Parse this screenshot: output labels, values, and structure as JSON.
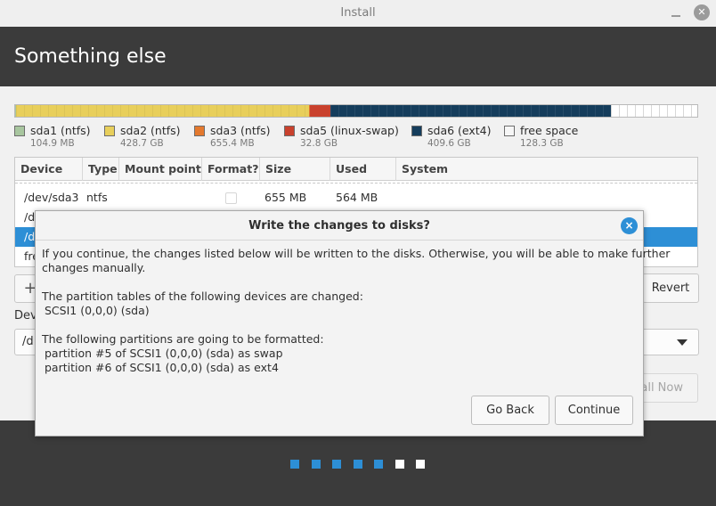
{
  "window": {
    "title": "Install"
  },
  "header": {
    "title": "Something else"
  },
  "partition_bar": [
    {
      "color": "#a8c69f",
      "share": 0.0001
    },
    {
      "color": "#e8cf5b",
      "share": 0.43
    },
    {
      "color": "#e4792e",
      "share": 0.0008
    },
    {
      "color": "#c9412d",
      "share": 0.03
    },
    {
      "color": "#153d5c",
      "share": 0.412
    },
    {
      "color": "#ffffff",
      "share": 0.127
    }
  ],
  "legend": [
    {
      "name": "sda1 (ntfs)",
      "size": "104.9 MB",
      "color": "#a8c69f"
    },
    {
      "name": "sda2 (ntfs)",
      "size": "428.7 GB",
      "color": "#e8cf5b"
    },
    {
      "name": "sda3 (ntfs)",
      "size": "655.4 MB",
      "color": "#e4792e"
    },
    {
      "name": "sda5 (linux-swap)",
      "size": "32.8 GB",
      "color": "#c9412d"
    },
    {
      "name": "sda6 (ext4)",
      "size": "409.6 GB",
      "color": "#153d5c"
    },
    {
      "name": "free space",
      "size": "128.3 GB",
      "color": "#f6f6f6"
    }
  ],
  "table": {
    "columns": [
      "Device",
      "Type",
      "Mount point",
      "Format?",
      "Size",
      "Used",
      "System"
    ],
    "rows": [
      {
        "device": "/dev/sda3",
        "type": "ntfs",
        "mount": "",
        "size": "655 MB",
        "used": "564 MB",
        "system": ""
      },
      {
        "device": "/d",
        "type": "",
        "mount": "",
        "size": "",
        "used": "",
        "system": ""
      },
      {
        "device": "/d",
        "type": "",
        "mount": "",
        "size": "",
        "used": "",
        "system": ""
      },
      {
        "device": "fre",
        "type": "",
        "mount": "",
        "size": "",
        "used": "",
        "system": ""
      }
    ]
  },
  "controls": {
    "add_label": "+",
    "revert_label": "Revert",
    "device_label": "Dev",
    "device_value": "/d",
    "install_now_label": "all Now"
  },
  "dialog": {
    "title": "Write the changes to disks?",
    "close_glyph": "×",
    "intro_line1": "If you continue, the changes listed below will be written to the disks. Otherwise, you will be able to make further",
    "intro_line2": "changes manually.",
    "tables_heading": "The partition tables of the following devices are changed:",
    "tables_device": "SCSI1 (0,0,0) (sda)",
    "format_heading": "The following partitions are going to be formatted:",
    "format_items": [
      "partition #5 of SCSI1 (0,0,0) (sda) as swap",
      "partition #6 of SCSI1 (0,0,0) (sda) as ext4"
    ],
    "go_back_label": "Go Back",
    "continue_label": "Continue"
  },
  "progress_dots": {
    "total": 7,
    "completed": 5,
    "completed_color": "#2d8fd6",
    "pending_color": "#ffffff"
  }
}
